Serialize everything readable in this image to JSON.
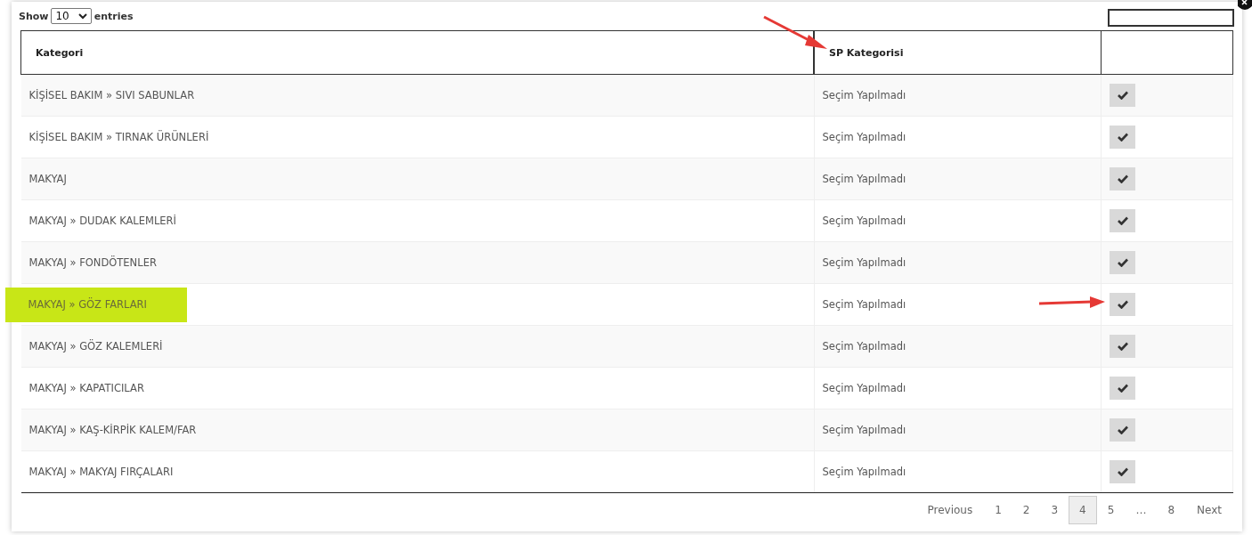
{
  "length_menu": {
    "label_before": "Show",
    "value": "10",
    "label_after": "entries"
  },
  "table": {
    "columns": [
      "Kategori",
      "SP Kategorisi"
    ],
    "rows": [
      {
        "category": "KİŞİSEL BAKIM » SIVI SABUNLAR",
        "sp_category": "Seçim Yapılmadı",
        "highlighted": false
      },
      {
        "category": "KİŞİSEL BAKIM » TIRNAK ÜRÜNLERİ",
        "sp_category": "Seçim Yapılmadı",
        "highlighted": false
      },
      {
        "category": "MAKYAJ",
        "sp_category": "Seçim Yapılmadı",
        "highlighted": false
      },
      {
        "category": "MAKYAJ » DUDAK KALEMLERİ",
        "sp_category": "Seçim Yapılmadı",
        "highlighted": false
      },
      {
        "category": "MAKYAJ » FONDÖTENLER",
        "sp_category": "Seçim Yapılmadı",
        "highlighted": false
      },
      {
        "category": "MAKYAJ » GÖZ FARLARI",
        "sp_category": "Seçim Yapılmadı",
        "highlighted": true
      },
      {
        "category": "MAKYAJ » GÖZ KALEMLERİ",
        "sp_category": "Seçim Yapılmadı",
        "highlighted": false
      },
      {
        "category": "MAKYAJ » KAPATICILAR",
        "sp_category": "Seçim Yapılmadı",
        "highlighted": false
      },
      {
        "category": "MAKYAJ » KAŞ-KİRPİK KALEM/FAR",
        "sp_category": "Seçim Yapılmadı",
        "highlighted": false
      },
      {
        "category": "MAKYAJ » MAKYAJ FIRÇALARI",
        "sp_category": "Seçim Yapılmadı",
        "highlighted": false
      }
    ]
  },
  "pagination": [
    {
      "label": "Previous",
      "kind": "nav",
      "selected": false
    },
    {
      "label": "1",
      "kind": "page",
      "selected": false
    },
    {
      "label": "2",
      "kind": "page",
      "selected": false
    },
    {
      "label": "3",
      "kind": "page",
      "selected": false
    },
    {
      "label": "4",
      "kind": "page",
      "selected": true
    },
    {
      "label": "5",
      "kind": "page",
      "selected": false
    },
    {
      "label": "…",
      "kind": "ellipsis",
      "selected": false
    },
    {
      "label": "8",
      "kind": "page",
      "selected": false
    },
    {
      "label": "Next",
      "kind": "nav",
      "selected": false
    }
  ]
}
